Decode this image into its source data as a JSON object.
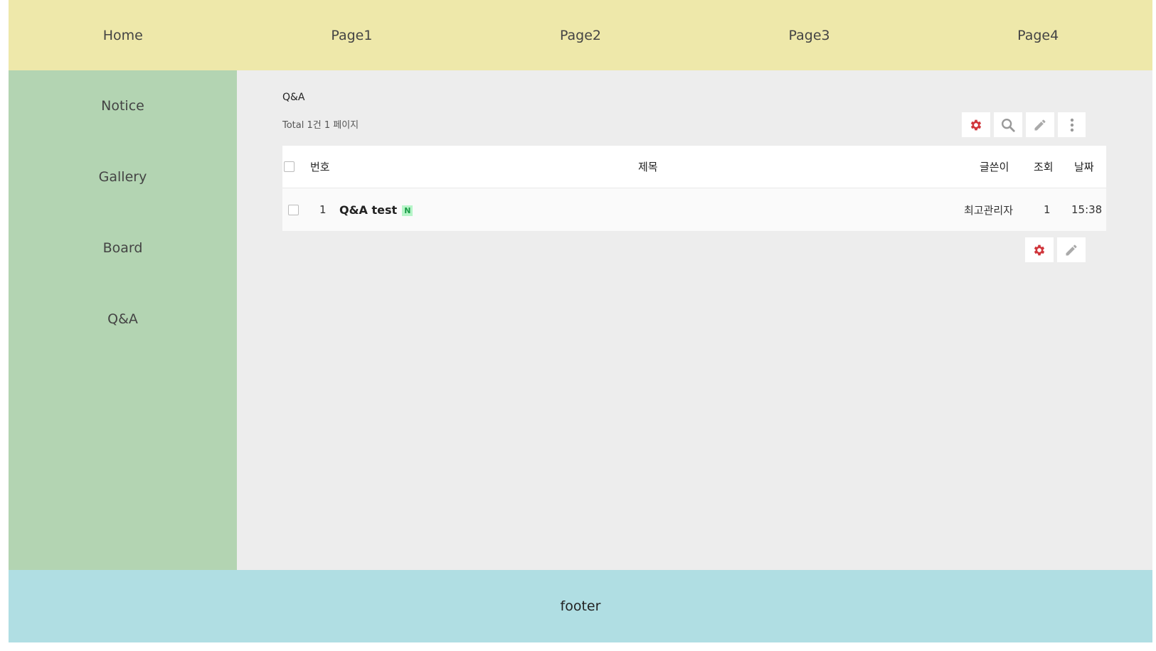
{
  "topnav": {
    "items": [
      {
        "label": "Home"
      },
      {
        "label": "Page1"
      },
      {
        "label": "Page2"
      },
      {
        "label": "Page3"
      },
      {
        "label": "Page4"
      }
    ]
  },
  "sidebar": {
    "items": [
      {
        "label": "Notice"
      },
      {
        "label": "Gallery"
      },
      {
        "label": "Board"
      },
      {
        "label": "Q&A"
      }
    ]
  },
  "board": {
    "title": "Q&A",
    "total": "Total 1건 1 페이지",
    "top_buttons": [
      "gear-icon",
      "search-icon",
      "pencil-icon",
      "more-vertical-icon"
    ],
    "bottom_buttons": [
      "gear-icon",
      "pencil-icon"
    ],
    "columns": {
      "num": "번호",
      "subject": "제목",
      "writer": "글쓴이",
      "views": "조회",
      "date": "날짜"
    },
    "rows": [
      {
        "num": "1",
        "subject": "Q&A test",
        "badge": "N",
        "writer": "최고관리자",
        "views": "1",
        "date": "15:38"
      }
    ]
  },
  "footer": {
    "text": "footer"
  },
  "colors": {
    "topnav_bg": "#eee8aa",
    "sidebar_bg": "#b3d4b2",
    "main_bg": "#ededed",
    "footer_bg": "#b0dee3",
    "gear_accent": "#d0353b",
    "icon_gray": "#999999",
    "new_badge_bg": "#b6f5c8",
    "new_badge_text": "#1a9c46"
  }
}
